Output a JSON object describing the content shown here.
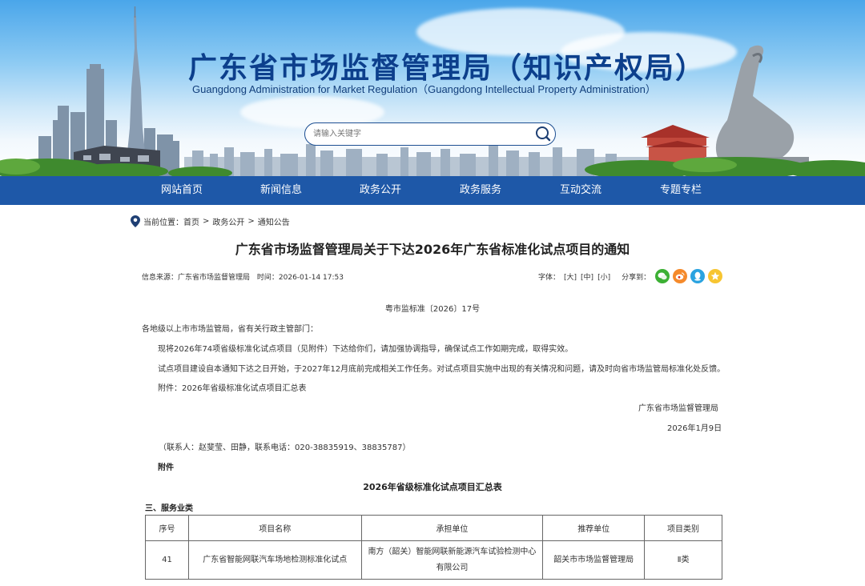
{
  "header": {
    "title_cn": "广东省市场监督管理局（知识产权局）",
    "title_en": "Guangdong Administration for Market Regulation（Guangdong Intellectual Property Administration）",
    "search_placeholder": "请输入关键字"
  },
  "nav": {
    "items": [
      "网站首页",
      "新闻信息",
      "政务公开",
      "政务服务",
      "互动交流",
      "专题专栏"
    ]
  },
  "breadcrumb": {
    "label": "当前位置：",
    "items": [
      "首页",
      "政务公开",
      "通知公告"
    ],
    "separator": ">"
  },
  "article": {
    "title": "广东省市场监督管理局关于下达2026年广东省标准化试点项目的通知",
    "source": "信息来源：广东省市场监督管理局",
    "time": "时间：2026-01-14 17:53",
    "font_label": "字体：",
    "font_sizes": [
      "[大]",
      "[中]",
      "[小]"
    ],
    "share_label": "分享到：",
    "doc_number": "粤市监标准〔2026〕17号",
    "addressee": "各地级以上市市场监管局，省有关行政主管部门：",
    "paragraphs": [
      "现将2026年74项省级标准化试点项目（见附件）下达给你们，请加强协调指导，确保试点工作如期完成，取得实效。",
      "试点项目建设自本通知下达之日开始，于2027年12月底前完成相关工作任务。对试点项目实施中出现的有关情况和问题，请及时向省市场监管局标准化处反馈。",
      "附件：2026年省级标准化试点项目汇总表"
    ],
    "signature": "广东省市场监督管理局",
    "date": "2026年1月9日",
    "contact": "（联系人：赵斐莹、田静，联系电话：020-38835919、38835787）",
    "attachment_label": "附件",
    "summary_title": "2026年省级标准化试点项目汇总表",
    "section_label": "三、服务业类"
  },
  "table": {
    "headers": [
      "序号",
      "项目名称",
      "承担单位",
      "推荐单位",
      "项目类别"
    ],
    "rows": [
      [
        "41",
        "广东省智能网联汽车场地检测标准化试点",
        "南方（韶关）智能网联新能源汽车试验检测中心有限公司",
        "韶关市市场监督管理局",
        "Ⅱ类"
      ]
    ]
  },
  "colors": {
    "nav_bg": "#1e58a8",
    "title_blue": "#0c3f8c",
    "wechat": "#3cb034",
    "weibo": "#f58a2b",
    "qq": "#2aa3e0",
    "qzone": "#f7c531"
  },
  "icons": [
    "search-icon",
    "location-pin-icon",
    "wechat-icon",
    "weibo-icon",
    "qq-icon",
    "qzone-icon"
  ]
}
